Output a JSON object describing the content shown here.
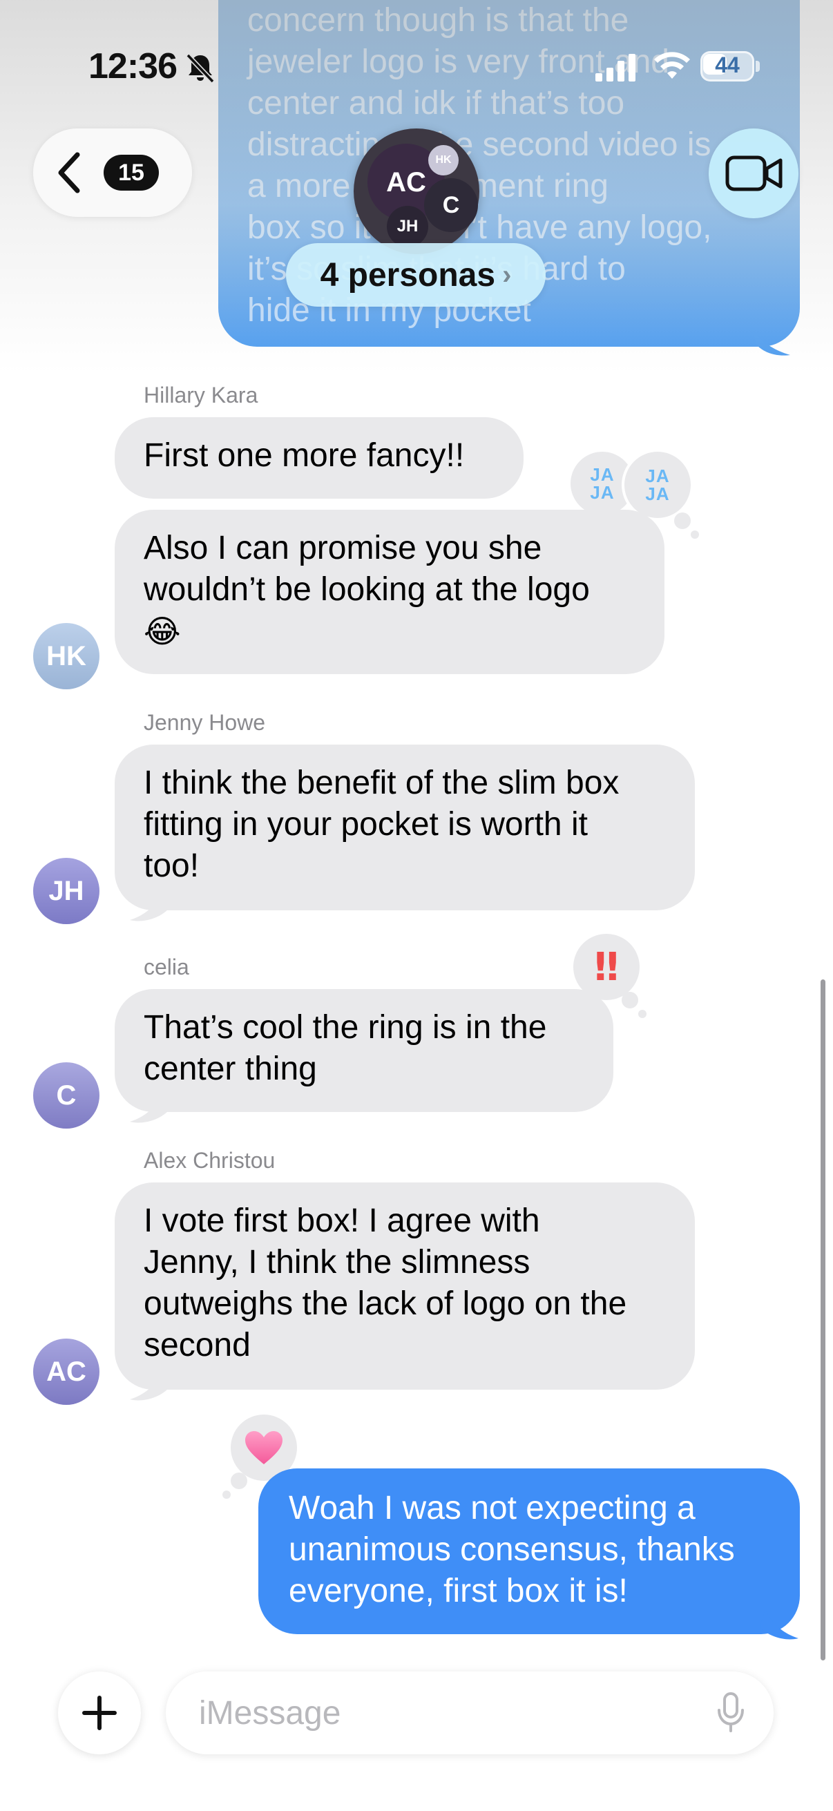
{
  "status_bar": {
    "time": "12:36",
    "battery": "44"
  },
  "header": {
    "back_badge": "15",
    "group_avatars": [
      "AC",
      "HK",
      "C",
      "JH"
    ],
    "group_name": "4 personas",
    "group_chevron": "›"
  },
  "top_message": {
    "lines": [
      "concern though is that the",
      "jeweler logo is very front and",
      "center and idk if that’s too",
      "distracting. The second video is",
      "a more engagement ring",
      "box so it doesn’t have any logo,",
      "it’s so slim that it’s hard to",
      "hide it in my pocket"
    ]
  },
  "messages": [
    {
      "sender": "Hillary Kara",
      "initials": "HK",
      "bubbles": [
        {
          "text": "First one more fancy!!"
        },
        {
          "line1": "Also I can promise you she",
          "line2": "wouldn’t be looking at the logo",
          "emoji": "😂"
        }
      ],
      "tapback_text": "JA\nJA"
    },
    {
      "sender": "Jenny Howe",
      "initials": "JH",
      "line1": "I think the benefit of the slim box",
      "line2": "fitting in your pocket is worth it",
      "line3": "too!"
    },
    {
      "sender": "celia",
      "initials": "C",
      "line1": "That’s cool the ring is in the",
      "line2": "center thing",
      "tapback": "‼"
    },
    {
      "sender": "Alex Christou",
      "initials": "AC",
      "line1": "I vote first box! I agree with",
      "line2": "Jenny, I think the slimness",
      "line3": "outweighs the lack of logo on the",
      "line4": "second"
    }
  ],
  "outgoing": {
    "line1": "Woah I was not expecting a",
    "line2": "unanimous consensus, thanks",
    "line3": "everyone, first box it is!",
    "tapback": "heart"
  },
  "composer": {
    "placeholder": "iMessage",
    "plus": "+"
  },
  "colors": {
    "incoming_bubble": "#e9e9eb",
    "outgoing_bubble": "#3f8ef7",
    "sender_name": "#8a8a8e"
  },
  "icons": [
    "bell-slash-icon",
    "cellular-signal-icon",
    "wifi-icon",
    "battery-icon",
    "chevron-left-icon",
    "video-camera-icon",
    "plus-icon",
    "microphone-icon",
    "heart-icon",
    "double-exclamation-icon",
    "haha-icon"
  ]
}
